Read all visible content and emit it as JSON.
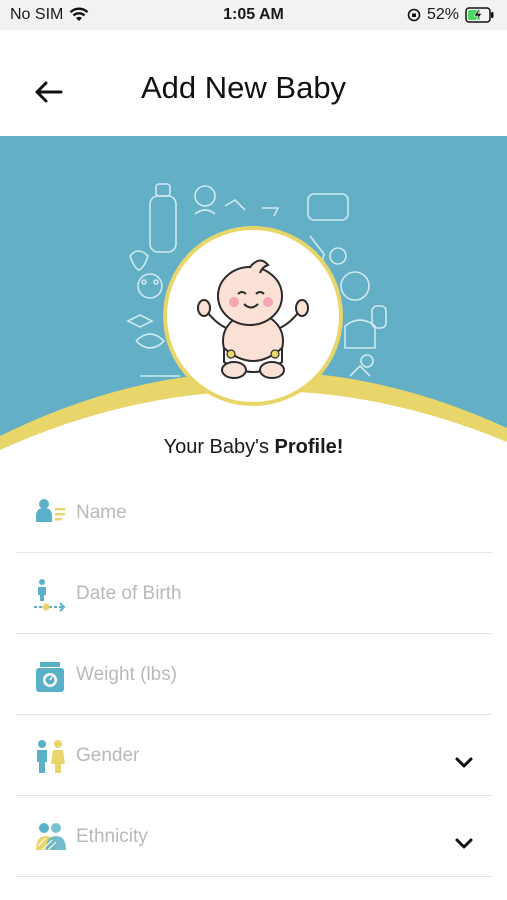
{
  "status_bar": {
    "carrier": "No SIM",
    "time": "1:05 AM",
    "battery": "52%"
  },
  "header": {
    "title": "Add New Baby"
  },
  "caption": {
    "prefix": "Your Baby's ",
    "emphasis": "Profile!"
  },
  "form": {
    "fields": [
      {
        "label": "Name",
        "icon": "name-icon"
      },
      {
        "label": "Date of Birth",
        "icon": "date-of-birth-icon"
      },
      {
        "label": "Weight (lbs)",
        "icon": "scale-icon"
      },
      {
        "label": "Gender",
        "icon": "gender-icon"
      },
      {
        "label": "Ethnicity",
        "icon": "ethnicity-icon"
      }
    ]
  },
  "colors": {
    "banner": "#63afc6",
    "accent_yellow": "#e8d66a",
    "icon_teal": "#5ab1c7",
    "placeholder": "#b9b9b9"
  }
}
